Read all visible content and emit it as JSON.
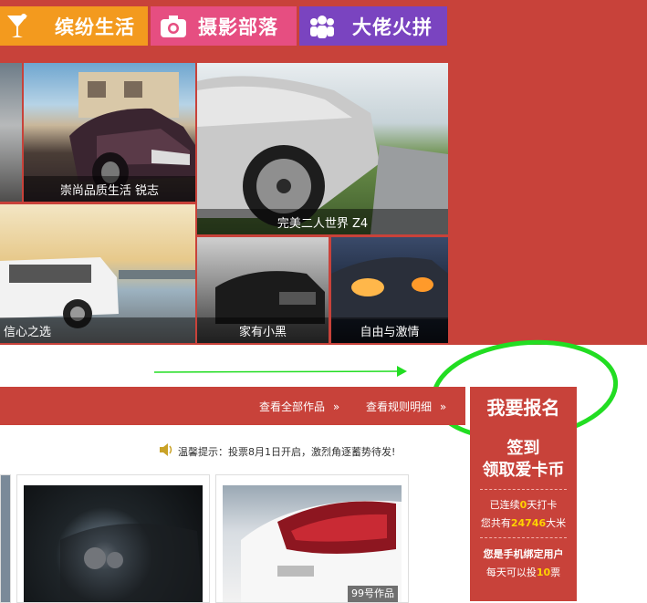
{
  "nav": {
    "tabs": [
      {
        "label": "缤纷生活",
        "icon": "cocktail-icon"
      },
      {
        "label": "摄影部落",
        "icon": "camera-icon"
      },
      {
        "label": "大佬火拼",
        "icon": "group-icon"
      }
    ]
  },
  "gallery": {
    "captions": [
      "崇尚品质生活 锐志",
      "完美二人世界 Z4",
      "信心之选",
      "家有小黑",
      "自由与激情"
    ]
  },
  "links": {
    "view_all": "查看全部作品",
    "view_rules": "查看规则明细"
  },
  "signup": {
    "button": "我要报名",
    "checkin_title_1": "签到",
    "checkin_title_2": "领取爱卡币",
    "streak_prefix": "已连续",
    "streak_days": "0",
    "streak_suffix": "天打卡",
    "total_prefix": "您共有",
    "total_value": "24746",
    "total_suffix": "大米",
    "phone_title": "您是手机绑定用户",
    "votes_prefix": "每天可以投",
    "votes_value": "10",
    "votes_suffix": "票"
  },
  "notice": {
    "text": "温馨提示：投票8月1日开启，激烈角逐蓄势待发!"
  },
  "works": {
    "label": "99号作品"
  },
  "colors": {
    "brand_red": "#c8423a",
    "tab_orange": "#f39a1e",
    "tab_pink": "#e64e81",
    "tab_purple": "#7a44c0",
    "annotation_green": "#22dd22",
    "highlight_yellow": "#ffd200"
  }
}
